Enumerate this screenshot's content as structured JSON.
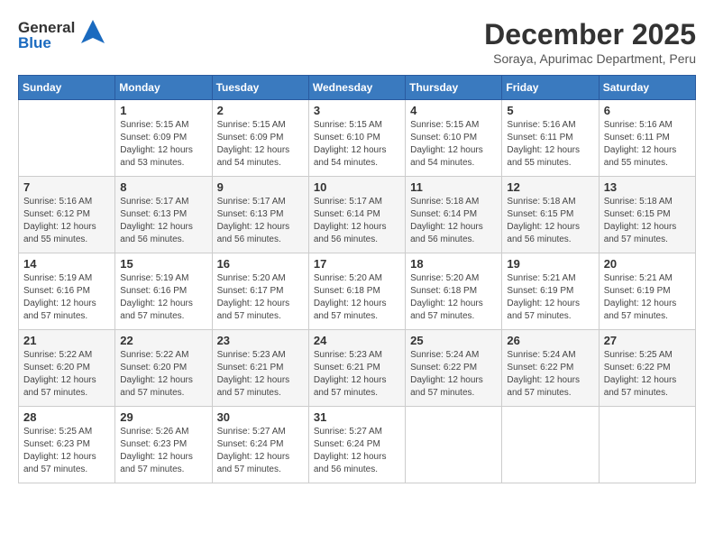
{
  "logo": {
    "general": "General",
    "blue": "Blue"
  },
  "header": {
    "month_year": "December 2025",
    "location": "Soraya, Apurimac Department, Peru"
  },
  "weekdays": [
    "Sunday",
    "Monday",
    "Tuesday",
    "Wednesday",
    "Thursday",
    "Friday",
    "Saturday"
  ],
  "weeks": [
    [
      {
        "day": "",
        "sunrise": "",
        "sunset": "",
        "daylight": ""
      },
      {
        "day": "1",
        "sunrise": "Sunrise: 5:15 AM",
        "sunset": "Sunset: 6:09 PM",
        "daylight": "Daylight: 12 hours and 53 minutes."
      },
      {
        "day": "2",
        "sunrise": "Sunrise: 5:15 AM",
        "sunset": "Sunset: 6:09 PM",
        "daylight": "Daylight: 12 hours and 54 minutes."
      },
      {
        "day": "3",
        "sunrise": "Sunrise: 5:15 AM",
        "sunset": "Sunset: 6:10 PM",
        "daylight": "Daylight: 12 hours and 54 minutes."
      },
      {
        "day": "4",
        "sunrise": "Sunrise: 5:15 AM",
        "sunset": "Sunset: 6:10 PM",
        "daylight": "Daylight: 12 hours and 54 minutes."
      },
      {
        "day": "5",
        "sunrise": "Sunrise: 5:16 AM",
        "sunset": "Sunset: 6:11 PM",
        "daylight": "Daylight: 12 hours and 55 minutes."
      },
      {
        "day": "6",
        "sunrise": "Sunrise: 5:16 AM",
        "sunset": "Sunset: 6:11 PM",
        "daylight": "Daylight: 12 hours and 55 minutes."
      }
    ],
    [
      {
        "day": "7",
        "sunrise": "Sunrise: 5:16 AM",
        "sunset": "Sunset: 6:12 PM",
        "daylight": "Daylight: 12 hours and 55 minutes."
      },
      {
        "day": "8",
        "sunrise": "Sunrise: 5:17 AM",
        "sunset": "Sunset: 6:13 PM",
        "daylight": "Daylight: 12 hours and 56 minutes."
      },
      {
        "day": "9",
        "sunrise": "Sunrise: 5:17 AM",
        "sunset": "Sunset: 6:13 PM",
        "daylight": "Daylight: 12 hours and 56 minutes."
      },
      {
        "day": "10",
        "sunrise": "Sunrise: 5:17 AM",
        "sunset": "Sunset: 6:14 PM",
        "daylight": "Daylight: 12 hours and 56 minutes."
      },
      {
        "day": "11",
        "sunrise": "Sunrise: 5:18 AM",
        "sunset": "Sunset: 6:14 PM",
        "daylight": "Daylight: 12 hours and 56 minutes."
      },
      {
        "day": "12",
        "sunrise": "Sunrise: 5:18 AM",
        "sunset": "Sunset: 6:15 PM",
        "daylight": "Daylight: 12 hours and 56 minutes."
      },
      {
        "day": "13",
        "sunrise": "Sunrise: 5:18 AM",
        "sunset": "Sunset: 6:15 PM",
        "daylight": "Daylight: 12 hours and 57 minutes."
      }
    ],
    [
      {
        "day": "14",
        "sunrise": "Sunrise: 5:19 AM",
        "sunset": "Sunset: 6:16 PM",
        "daylight": "Daylight: 12 hours and 57 minutes."
      },
      {
        "day": "15",
        "sunrise": "Sunrise: 5:19 AM",
        "sunset": "Sunset: 6:16 PM",
        "daylight": "Daylight: 12 hours and 57 minutes."
      },
      {
        "day": "16",
        "sunrise": "Sunrise: 5:20 AM",
        "sunset": "Sunset: 6:17 PM",
        "daylight": "Daylight: 12 hours and 57 minutes."
      },
      {
        "day": "17",
        "sunrise": "Sunrise: 5:20 AM",
        "sunset": "Sunset: 6:18 PM",
        "daylight": "Daylight: 12 hours and 57 minutes."
      },
      {
        "day": "18",
        "sunrise": "Sunrise: 5:20 AM",
        "sunset": "Sunset: 6:18 PM",
        "daylight": "Daylight: 12 hours and 57 minutes."
      },
      {
        "day": "19",
        "sunrise": "Sunrise: 5:21 AM",
        "sunset": "Sunset: 6:19 PM",
        "daylight": "Daylight: 12 hours and 57 minutes."
      },
      {
        "day": "20",
        "sunrise": "Sunrise: 5:21 AM",
        "sunset": "Sunset: 6:19 PM",
        "daylight": "Daylight: 12 hours and 57 minutes."
      }
    ],
    [
      {
        "day": "21",
        "sunrise": "Sunrise: 5:22 AM",
        "sunset": "Sunset: 6:20 PM",
        "daylight": "Daylight: 12 hours and 57 minutes."
      },
      {
        "day": "22",
        "sunrise": "Sunrise: 5:22 AM",
        "sunset": "Sunset: 6:20 PM",
        "daylight": "Daylight: 12 hours and 57 minutes."
      },
      {
        "day": "23",
        "sunrise": "Sunrise: 5:23 AM",
        "sunset": "Sunset: 6:21 PM",
        "daylight": "Daylight: 12 hours and 57 minutes."
      },
      {
        "day": "24",
        "sunrise": "Sunrise: 5:23 AM",
        "sunset": "Sunset: 6:21 PM",
        "daylight": "Daylight: 12 hours and 57 minutes."
      },
      {
        "day": "25",
        "sunrise": "Sunrise: 5:24 AM",
        "sunset": "Sunset: 6:22 PM",
        "daylight": "Daylight: 12 hours and 57 minutes."
      },
      {
        "day": "26",
        "sunrise": "Sunrise: 5:24 AM",
        "sunset": "Sunset: 6:22 PM",
        "daylight": "Daylight: 12 hours and 57 minutes."
      },
      {
        "day": "27",
        "sunrise": "Sunrise: 5:25 AM",
        "sunset": "Sunset: 6:22 PM",
        "daylight": "Daylight: 12 hours and 57 minutes."
      }
    ],
    [
      {
        "day": "28",
        "sunrise": "Sunrise: 5:25 AM",
        "sunset": "Sunset: 6:23 PM",
        "daylight": "Daylight: 12 hours and 57 minutes."
      },
      {
        "day": "29",
        "sunrise": "Sunrise: 5:26 AM",
        "sunset": "Sunset: 6:23 PM",
        "daylight": "Daylight: 12 hours and 57 minutes."
      },
      {
        "day": "30",
        "sunrise": "Sunrise: 5:27 AM",
        "sunset": "Sunset: 6:24 PM",
        "daylight": "Daylight: 12 hours and 57 minutes."
      },
      {
        "day": "31",
        "sunrise": "Sunrise: 5:27 AM",
        "sunset": "Sunset: 6:24 PM",
        "daylight": "Daylight: 12 hours and 56 minutes."
      },
      {
        "day": "",
        "sunrise": "",
        "sunset": "",
        "daylight": ""
      },
      {
        "day": "",
        "sunrise": "",
        "sunset": "",
        "daylight": ""
      },
      {
        "day": "",
        "sunrise": "",
        "sunset": "",
        "daylight": ""
      }
    ]
  ]
}
